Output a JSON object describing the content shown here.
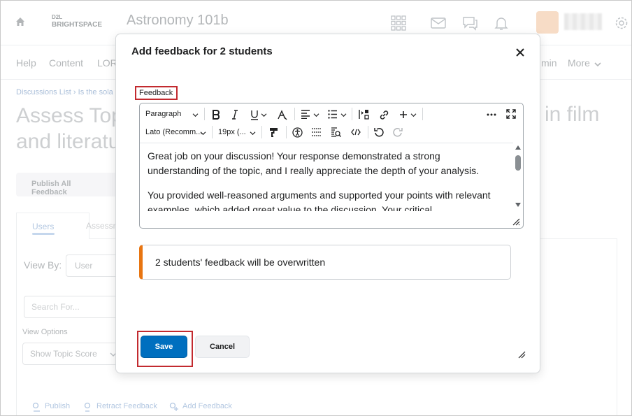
{
  "app": {
    "logo_line1": "D2L",
    "logo_line2": "BRIGHTSPACE",
    "course_title": "Astronomy 101b"
  },
  "nav": {
    "items": [
      "Help",
      "Content",
      "LOR",
      "min",
      "More"
    ]
  },
  "page": {
    "breadcrumb": "Discussions List  ›  Is the sola",
    "title_line1": "Assess Top",
    "title_line2": "and literatu",
    "title_right": "in film",
    "publish_all": "Publish All Feedback",
    "tab_users": "Users",
    "tab_assess": "Assessm",
    "view_by_label": "View By:",
    "view_by_value": "User",
    "search_placeholder": "Search For...",
    "view_options": "View Options",
    "show_topic": "Show Topic Score",
    "actions": [
      "Publish",
      "Retract Feedback",
      "Add Feedback"
    ]
  },
  "dialog": {
    "title": "Add feedback for 2 students",
    "feedback_label": "Feedback",
    "toolbar": {
      "paragraph": "Paragraph",
      "font": "Lato (Recomm...",
      "size": "19px (..."
    },
    "paragraph1": "Great job on your discussion! Your response demonstrated a strong understanding of the topic, and I really appreciate the depth of your analysis.",
    "paragraph2": "You provided well-reasoned arguments and supported your points with relevant examples, which added great value to the discussion. Your critical",
    "warning": "2 students' feedback will be overwritten",
    "save_label": "Save",
    "cancel_label": "Cancel"
  },
  "colors": {
    "primary": "#006fbf",
    "warning": "#e87511",
    "highlight": "#c22a2f"
  }
}
